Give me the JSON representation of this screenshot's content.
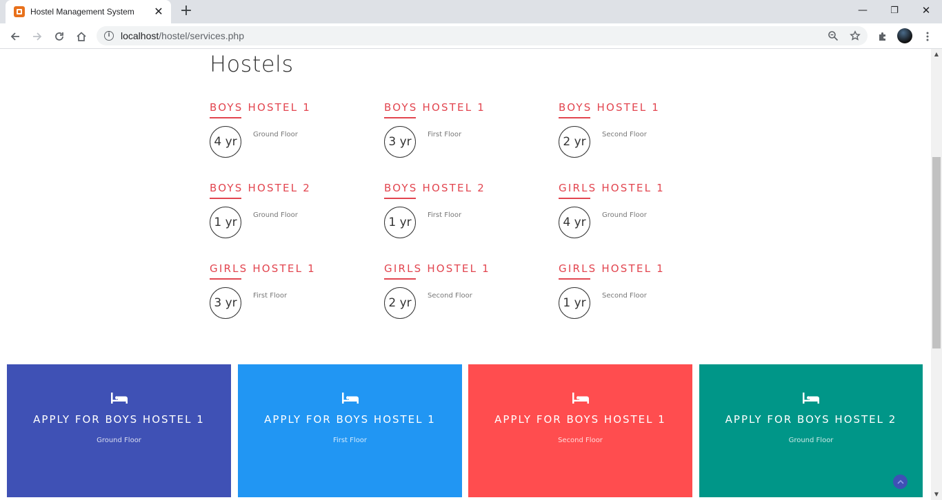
{
  "browser": {
    "tab_title": "Hostel Management System",
    "tab_close": "✕",
    "new_tab": "+",
    "url_host": "localhost",
    "url_path": "/hostel/services.php",
    "window_minimize": "—",
    "window_restore": "❐",
    "window_close": "✕"
  },
  "page": {
    "heading": "Hostels",
    "hostels": [
      {
        "name": "Boys Hostel 1",
        "years": "4 yr",
        "floor": "Ground Floor"
      },
      {
        "name": "Boys Hostel 1",
        "years": "3 yr",
        "floor": "First Floor"
      },
      {
        "name": "Boys Hostel 1",
        "years": "2 yr",
        "floor": "Second Floor"
      },
      {
        "name": "Boys Hostel 2",
        "years": "1 yr",
        "floor": "Ground Floor"
      },
      {
        "name": "Boys Hostel 2",
        "years": "1 yr",
        "floor": "First Floor"
      },
      {
        "name": "Girls Hostel 1",
        "years": "4 yr",
        "floor": "Ground Floor"
      },
      {
        "name": "Girls Hostel 1",
        "years": "3 yr",
        "floor": "First Floor"
      },
      {
        "name": "Girls Hostel 1",
        "years": "2 yr",
        "floor": "Second Floor"
      },
      {
        "name": "Girls Hostel 1",
        "years": "1 yr",
        "floor": "Second Floor"
      }
    ],
    "apply_cards": [
      {
        "title": "Apply for Boys Hostel 1",
        "floor": "Ground Floor",
        "color": "#3f51b5"
      },
      {
        "title": "Apply for Boys Hostel 1",
        "floor": "First Floor",
        "color": "#2196f3"
      },
      {
        "title": "Apply for Boys Hostel 1",
        "floor": "Second Floor",
        "color": "#ff4d4f"
      },
      {
        "title": "Apply for Boys Hostel 2",
        "floor": "Ground Floor",
        "color": "#009688"
      }
    ]
  }
}
